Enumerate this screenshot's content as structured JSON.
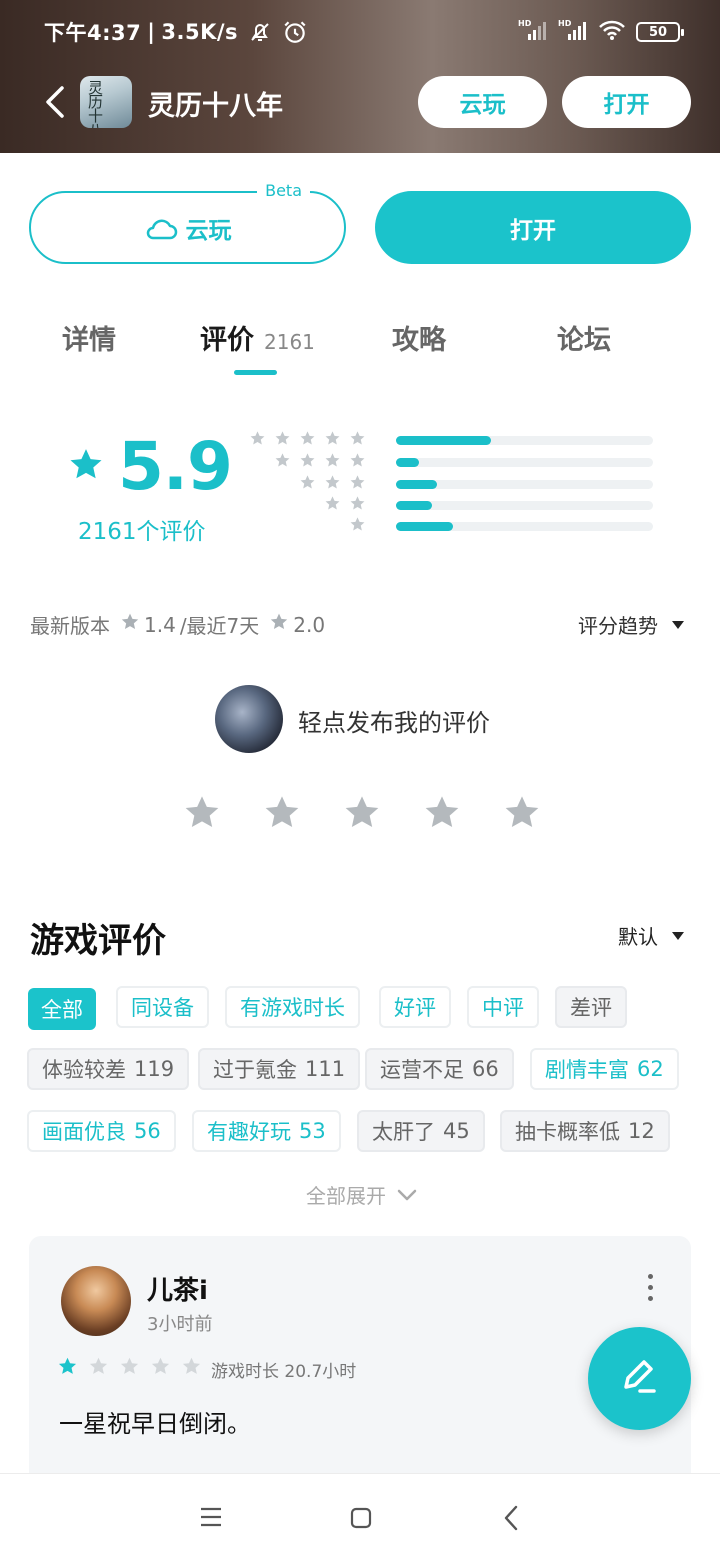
{
  "status_bar": {
    "time": "下午4:37",
    "speed": "3.5K/s",
    "battery": "50",
    "icons": [
      "bell-off-icon",
      "alarm-icon",
      "signal-hd-icon",
      "signal-hd-icon",
      "wifi-icon",
      "battery-icon"
    ]
  },
  "header": {
    "app_title": "灵历十八年",
    "app_icon_text": "灵历十八年",
    "cloud_label": "云玩",
    "open_label": "打开"
  },
  "actions": {
    "cloud_label": "云玩",
    "beta_label": "Beta",
    "open_label": "打开"
  },
  "tabs": [
    {
      "label": "详情"
    },
    {
      "label": "评价",
      "count": "2161"
    },
    {
      "label": "攻略"
    },
    {
      "label": "论坛"
    }
  ],
  "rating": {
    "score": "5.9",
    "review_count_label": "2161个评价",
    "distribution": [
      {
        "stars": 5,
        "fraction": 0.37
      },
      {
        "stars": 4,
        "fraction": 0.09
      },
      {
        "stars": 3,
        "fraction": 0.16
      },
      {
        "stars": 2,
        "fraction": 0.14
      },
      {
        "stars": 1,
        "fraction": 0.22
      }
    ]
  },
  "version_info": {
    "latest_label": "最新版本",
    "latest_score": "1.4",
    "recent_label": "/最近7天",
    "recent_score": "2.0",
    "trend_label": "评分趋势"
  },
  "post_review": {
    "hint": "轻点发布我的评价",
    "star_count": 5
  },
  "reviews_section": {
    "title": "游戏评价",
    "sort_label": "默认",
    "filters": [
      {
        "label": "全部",
        "kind": "sel"
      },
      {
        "label": "同设备",
        "kind": "pos"
      },
      {
        "label": "有游戏时长",
        "kind": "pos"
      },
      {
        "label": "好评",
        "kind": "pos"
      },
      {
        "label": "中评",
        "kind": "pos"
      },
      {
        "label": "差评",
        "kind": "neg"
      }
    ],
    "tags": [
      {
        "label": "体验较差",
        "count": "119",
        "kind": "neg"
      },
      {
        "label": "过于氪金",
        "count": "111",
        "kind": "neg"
      },
      {
        "label": "运营不足",
        "count": "66",
        "kind": "neg"
      },
      {
        "label": "剧情丰富",
        "count": "62",
        "kind": "pos"
      },
      {
        "label": "画面优良",
        "count": "56",
        "kind": "pos"
      },
      {
        "label": "有趣好玩",
        "count": "53",
        "kind": "pos"
      },
      {
        "label": "太肝了",
        "count": "45",
        "kind": "neg"
      },
      {
        "label": "抽卡概率低",
        "count": "12",
        "kind": "neg"
      }
    ],
    "expand_label": "全部展开"
  },
  "review": {
    "username": "儿茶i",
    "time": "3小时前",
    "stars": 1,
    "playtime": "游戏时长 20.7小时",
    "comment": "一星祝早日倒闭。"
  },
  "colors": {
    "accent": "#1bc3cb",
    "star_gray": "#b4b9bd"
  }
}
